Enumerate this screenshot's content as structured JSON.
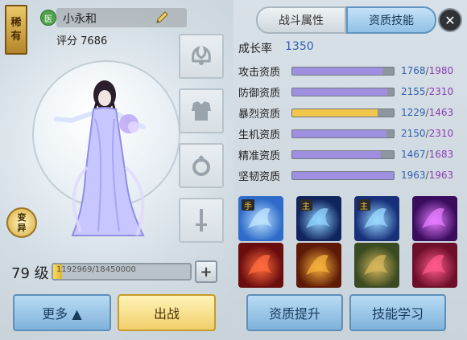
{
  "pet": {
    "rarity_label": [
      "稀",
      "有"
    ],
    "class_badge": "医",
    "name": "小永和",
    "score_label": "评分",
    "score_value": "7686",
    "transform_label": [
      "变",
      "异"
    ],
    "level_label": "79 级",
    "exp_text": "1192969/18450000",
    "exp_progress": 0.0646
  },
  "equipment_slots": [
    {
      "icon": "tiara-icon"
    },
    {
      "icon": "armor-icon"
    },
    {
      "icon": "ring-icon"
    },
    {
      "icon": "sword-icon"
    }
  ],
  "tabs": {
    "battle": "战斗属性",
    "aptitude": "资质技能",
    "active": "aptitude"
  },
  "growth": {
    "label": "成长率",
    "value": "1350"
  },
  "stats": [
    {
      "label": "攻击资质",
      "current": "1768",
      "max": "1980",
      "color": "#9f8fe0"
    },
    {
      "label": "防御资质",
      "current": "2155",
      "max": "2310",
      "color": "#9f8fe0"
    },
    {
      "label": "暴烈资质",
      "current": "1229",
      "max": "1463",
      "color": "#f2c64a"
    },
    {
      "label": "生机资质",
      "current": "2150",
      "max": "2310",
      "color": "#9f8fe0"
    },
    {
      "label": "精准资质",
      "current": "1467",
      "max": "1683",
      "color": "#9f8fe0"
    },
    {
      "label": "坚韧资质",
      "current": "1963",
      "max": "1963",
      "color": "#9f8fe0"
    }
  ],
  "skills": [
    {
      "icon": "lotus-hand-skill-icon",
      "tag": "手",
      "bg": "#2f6cc9",
      "accent": "#bfe4ff"
    },
    {
      "icon": "comet-skill-icon",
      "tag": "主",
      "bg": "#10245e",
      "accent": "#8fd3ff"
    },
    {
      "icon": "ice-shard-skill-icon",
      "tag": "主",
      "bg": "#17307a",
      "accent": "#9ad8ff"
    },
    {
      "icon": "purple-slash-skill-icon",
      "tag": "",
      "bg": "#3a0c5e",
      "accent": "#e57cff"
    },
    {
      "icon": "red-claw-skill-icon",
      "tag": "",
      "bg": "#6a0d0d",
      "accent": "#ff6b3d"
    },
    {
      "icon": "gold-armor-skill-icon",
      "tag": "",
      "bg": "#5e1a06",
      "accent": "#f6b03c"
    },
    {
      "icon": "beast-head-skill-icon",
      "tag": "",
      "bg": "#3a4a22",
      "accent": "#d6b75a"
    },
    {
      "icon": "pink-fist-skill-icon",
      "tag": "",
      "bg": "#6e0f2a",
      "accent": "#ff5a8a"
    }
  ],
  "buttons": {
    "more": "更多 ▲",
    "deploy": "出战",
    "aptitude_up": "资质提升",
    "skill_learn": "技能学习",
    "close": "✕",
    "plus": "+"
  }
}
